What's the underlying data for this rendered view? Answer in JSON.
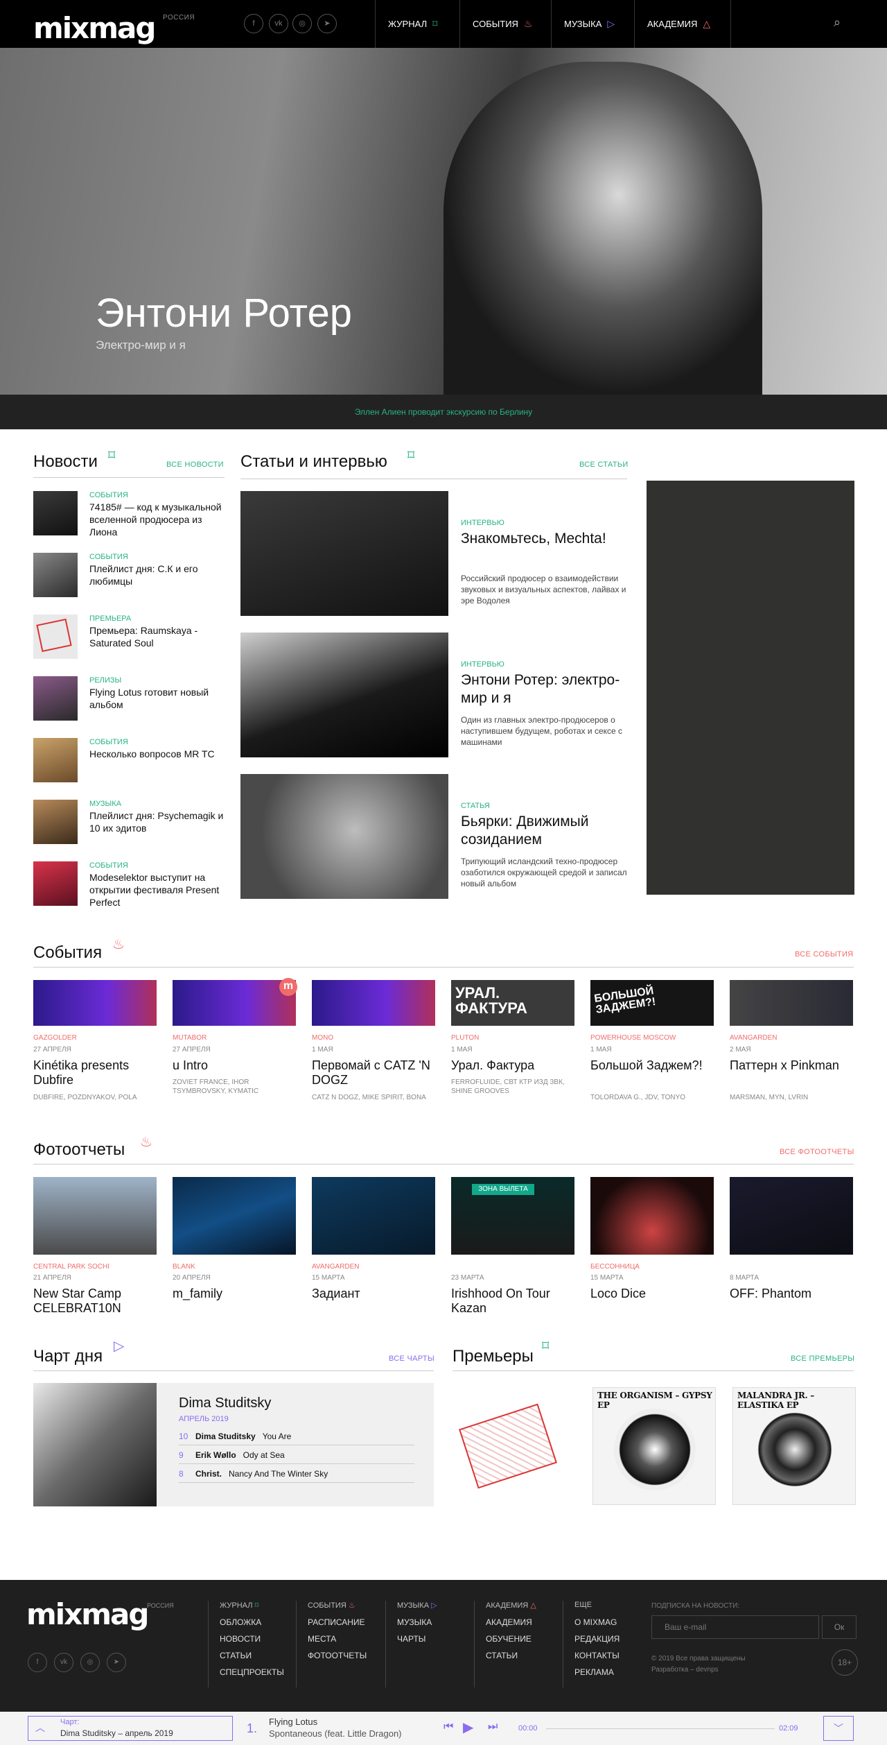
{
  "header": {
    "logo": "mixmag",
    "region": "РОССИЯ",
    "social": [
      "f",
      "vk",
      "ig",
      "tg"
    ],
    "nav": [
      {
        "label": "Журнал",
        "icon": "book-icon",
        "color": "#27b383"
      },
      {
        "label": "События",
        "icon": "flame-icon",
        "color": "#f26b6b"
      },
      {
        "label": "Музыка",
        "icon": "play-icon",
        "color": "#8a6cf0"
      },
      {
        "label": "Академия",
        "icon": "triangle-icon",
        "color": "#f26b6b"
      }
    ]
  },
  "hero": {
    "title": "Энтони Ротер",
    "subtitle": "Электро-мир и я"
  },
  "ticker": "Эллен Алиен проводит экскурсию по Берлину",
  "news": {
    "title": "Новости",
    "link": "Все новости",
    "items": [
      {
        "category": "События",
        "title": "74185# — код к музыкальной вселенной продюсера из Лиона"
      },
      {
        "category": "События",
        "title": "Плейлист дня: С.К и его любимцы"
      },
      {
        "category": "Премьера",
        "title": "Премьера: Raumskaya - Saturated Soul"
      },
      {
        "category": "Релизы",
        "title": "Flying Lotus готовит новый альбом"
      },
      {
        "category": "События",
        "title": "Несколько вопросов MR TC"
      },
      {
        "category": "Музыка",
        "title": "Плейлист дня: Psychemagik и 10 их эдитов"
      },
      {
        "category": "События",
        "title": "Modeselektor выступит на открытии фестиваля Present Perfect"
      }
    ]
  },
  "articles": {
    "title": "Статьи и интервью",
    "link": "Все статьи",
    "items": [
      {
        "category": "Интервью",
        "title": "Знакомьтесь, Mechta!",
        "desc": "Российский продюсер о взаимодействии звуковых и визуальных аспектов, лайвах и эре Водолея"
      },
      {
        "category": "Интервью",
        "title": "Энтони Ротер: электро-мир и я",
        "desc": "Один из главных электро-продюсеров о наступившем будущем, роботах и сексе с машинами"
      },
      {
        "category": "Статья",
        "title": "Бьярки: Движимый созиданием",
        "desc": "Трипующий исландский техно-продюсер озаботился окружающей средой и записал новый альбом"
      }
    ]
  },
  "events": {
    "title": "События",
    "link": "Все события",
    "items": [
      {
        "venue": "Gazgolder",
        "date": "27 апреля",
        "title": "Kinétika presents Dubfire",
        "meta": "Dubfire, Pozdnyakov, Pola"
      },
      {
        "venue": "Mutabor",
        "date": "27 апреля",
        "title": "u Intro",
        "meta": "Zoviet France, Ihor Tsymbrovsky, Kymatic"
      },
      {
        "venue": "Mono",
        "date": "1 мая",
        "title": "Первомай с CATZ 'N DOGZ",
        "meta": "Catz n Dogz, Mike Spirit, Bona"
      },
      {
        "venue": "Pluton",
        "date": "1 мая",
        "title": "Урал. Фактура",
        "meta": "Ferrofluide, СВТ КТР ИЗД ЗВК, Shine Grooves",
        "poster": "УРАЛ. ФАКТУРА"
      },
      {
        "venue": "Powerhouse Moscow",
        "date": "1 мая",
        "title": "Большой Заджем?!",
        "meta": "Tolordava G., JDV, Tonyo",
        "poster": "БОЛЬШОЙ ЗАДЖЕМ?!"
      },
      {
        "venue": "Avangarden",
        "date": "2 мая",
        "title": "Паттерн x Pinkman",
        "meta": "Marsman, MYN, Lvrin"
      }
    ]
  },
  "photos": {
    "title": "Фотоотчеты",
    "link": "Все фотоотчеты",
    "items": [
      {
        "venue": "Central Park Sochi",
        "date": "21 апреля",
        "title": "New Star Camp CELEBRAT10N"
      },
      {
        "venue": "Blank",
        "date": "20 апреля",
        "title": "m_family"
      },
      {
        "venue": "Avangarden",
        "date": "15 марта",
        "title": "Задиант"
      },
      {
        "venue": "",
        "date": "23 марта",
        "title": "Irishhood On Tour Kazan",
        "sign": "ЗОНА ВЫЛЕТА"
      },
      {
        "venue": "Бессонница",
        "date": "15 марта",
        "title": "Loco Dice"
      },
      {
        "venue": "",
        "date": "8 марта",
        "title": "OFF: Phantom"
      }
    ]
  },
  "chart_of_day": {
    "title": "Чарт дня",
    "link": "Все чарты",
    "artist": "Dima Studitsky",
    "month": "Апрель 2019",
    "rows": [
      {
        "num": "10",
        "artist": "Dima Studitsky",
        "track": "You Are"
      },
      {
        "num": "9",
        "artist": "Erik Wøllo",
        "track": "Ody at Sea"
      },
      {
        "num": "8",
        "artist": "Christ.",
        "track": "Nancy And The Winter Sky"
      }
    ]
  },
  "premieres": {
    "title": "Премьеры",
    "link": "Все премьеры",
    "covers": [
      "",
      "THE ORGANISM – GYPSY EP",
      "MALANDRA JR. – ELASTIKA EP"
    ]
  },
  "footer": {
    "logo": "mixmag",
    "region": "РОССИЯ",
    "cols": [
      {
        "head": "Журнал",
        "items": [
          "Обложка",
          "Новости",
          "Статьи",
          "Спецпроекты"
        ]
      },
      {
        "head": "События",
        "items": [
          "Расписание",
          "Места",
          "Фотоотчеты"
        ]
      },
      {
        "head": "Музыка",
        "items": [
          "Музыка",
          "Чарты"
        ]
      },
      {
        "head": "Академия",
        "items": [
          "Академия",
          "Обучение",
          "Статьи"
        ]
      },
      {
        "head": "Еще",
        "items": [
          "О Mixmag",
          "Редакция",
          "Контакты",
          "Реклама"
        ]
      }
    ],
    "subscribe_label": "Подписка на новости:",
    "email_placeholder": "Ваш e-mail",
    "subscribe_btn": "Ок",
    "copyright": "© 2019 Все права защищены",
    "dev": "Разработка – devnps",
    "age": "18+"
  },
  "player": {
    "chart_label": "Чарт:",
    "chart_name": "Dima Studitsky – апрель 2019",
    "num": "1.",
    "artist": "Flying Lotus",
    "track": "Spontaneous (feat. Little Dragon)",
    "time_current": "00:00",
    "time_total": "02:09"
  }
}
